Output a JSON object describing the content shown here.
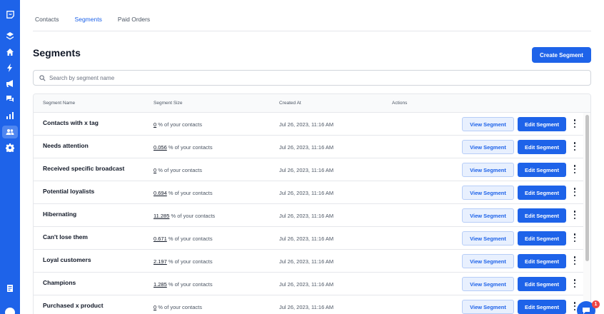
{
  "nav": {
    "icons": [
      "logo-icon",
      "layers-icon",
      "home-icon",
      "bolt-icon",
      "megaphone-icon",
      "chat-bubbles-icon",
      "bar-chart-icon",
      "users-icon",
      "gear-icon",
      "document-icon",
      "help-icon"
    ],
    "active": "users-icon"
  },
  "tabs": [
    {
      "label": "Contacts"
    },
    {
      "label": "Segments"
    },
    {
      "label": "Paid Orders"
    }
  ],
  "selected_tab": "Segments",
  "page": {
    "title": "Segments",
    "create_label": "Create Segment"
  },
  "search": {
    "placeholder": "Search by segment name",
    "value": ""
  },
  "table": {
    "columns": [
      "Segment Name",
      "Segment Size",
      "Created At",
      "Actions"
    ],
    "size_suffix": "% of your contacts",
    "view_label": "View Segment",
    "edit_label": "Edit Segment",
    "rows": [
      {
        "name": "Contacts with x tag",
        "size": "0",
        "created": "Jul 26, 2023, 11:16 AM"
      },
      {
        "name": "Needs attention",
        "size": "0.056",
        "created": "Jul 26, 2023, 11:16 AM"
      },
      {
        "name": "Received specific broadcast",
        "size": "0",
        "created": "Jul 26, 2023, 11:16 AM"
      },
      {
        "name": "Potential loyalists",
        "size": "0.694",
        "created": "Jul 26, 2023, 11:16 AM"
      },
      {
        "name": "Hibernating",
        "size": "11.285",
        "created": "Jul 26, 2023, 11:16 AM"
      },
      {
        "name": "Can't lose them",
        "size": "0.671",
        "created": "Jul 26, 2023, 11:16 AM"
      },
      {
        "name": "Loyal customers",
        "size": "2.197",
        "created": "Jul 26, 2023, 11:16 AM"
      },
      {
        "name": "Champions",
        "size": "1.285",
        "created": "Jul 26, 2023, 11:16 AM"
      },
      {
        "name": "Purchased x product",
        "size": "0",
        "created": "Jul 26, 2023, 11:16 AM"
      }
    ]
  },
  "chat_widget": {
    "badge": "1"
  },
  "colors": {
    "primary": "#1e63e9",
    "view_button_bg": "#e8f0fe",
    "badge": "#ef4444"
  }
}
